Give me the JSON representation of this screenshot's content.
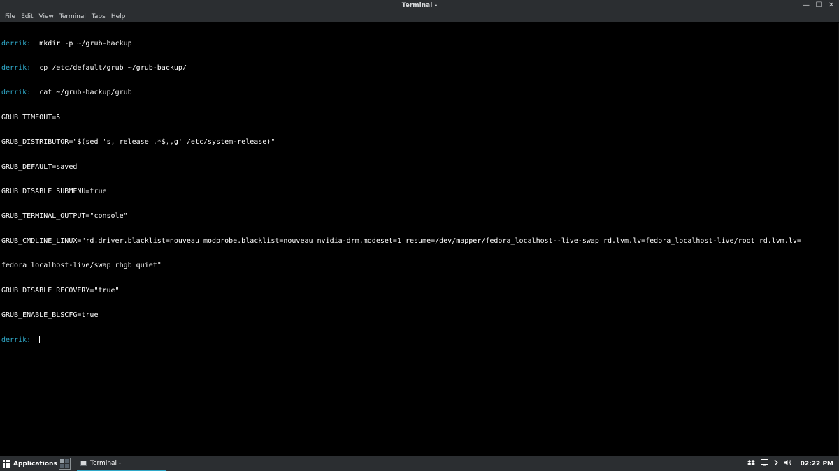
{
  "window": {
    "title": "Terminal -",
    "controls": {
      "minimize": "—",
      "maximize": "☐",
      "close": "✕"
    }
  },
  "menubar": {
    "items": [
      "File",
      "Edit",
      "View",
      "Terminal",
      "Tabs",
      "Help"
    ]
  },
  "terminal": {
    "lines": [
      {
        "prompt": "derrik:",
        "text": "  mkdir -p ~/grub-backup"
      },
      {
        "prompt": "derrik:",
        "text": "  cp /etc/default/grub ~/grub-backup/"
      },
      {
        "prompt": "derrik:",
        "text": "  cat ~/grub-backup/grub"
      },
      {
        "prompt": "",
        "text": "GRUB_TIMEOUT=5"
      },
      {
        "prompt": "",
        "text": "GRUB_DISTRIBUTOR=\"$(sed 's, release .*$,,g' /etc/system-release)\""
      },
      {
        "prompt": "",
        "text": "GRUB_DEFAULT=saved"
      },
      {
        "prompt": "",
        "text": "GRUB_DISABLE_SUBMENU=true"
      },
      {
        "prompt": "",
        "text": "GRUB_TERMINAL_OUTPUT=\"console\""
      },
      {
        "prompt": "",
        "text": "GRUB_CMDLINE_LINUX=\"rd.driver.blacklist=nouveau modprobe.blacklist=nouveau nvidia-drm.modeset=1 resume=/dev/mapper/fedora_localhost--live-swap rd.lvm.lv=fedora_localhost-live/root rd.lvm.lv="
      },
      {
        "prompt": "",
        "text": "fedora_localhost-live/swap rhgb quiet\""
      },
      {
        "prompt": "",
        "text": "GRUB_DISABLE_RECOVERY=\"true\""
      },
      {
        "prompt": "",
        "text": "GRUB_ENABLE_BLSCFG=true"
      }
    ],
    "current_prompt": "derrik:",
    "current_input": "  "
  },
  "taskbar": {
    "applications_label": "Applications",
    "task_label": "Terminal -",
    "clock": "02:22 PM",
    "tray_icons": [
      "dropbox-icon",
      "display-icon",
      "chevron-right-icon",
      "volume-icon"
    ],
    "colors": {
      "accent": "#2fa9c9",
      "panel": "#2b2e31"
    }
  }
}
